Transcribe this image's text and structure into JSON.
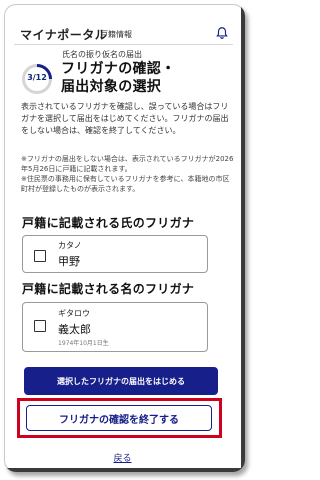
{
  "header": {
    "app_title": "マイナポータル",
    "section": "戸籍情報"
  },
  "progress": {
    "label": "3/12",
    "fraction": 0.25
  },
  "page": {
    "subheading": "氏名の振り仮名の届出",
    "title_line1": "フリガナの確認・",
    "title_line2": "届出対象の選択"
  },
  "description": "表示されているフリガナを確認し、誤っている場合はフリガナを選択して届出をはじめてください。フリガナの届出をしない場合は、確認を終了してください。",
  "notes": [
    "※フリガナの届出をしない場合は、表示されているフリガナが2026年5月26日に戸籍に記載されます。",
    "※住民票の事務用に保有しているフリガナを参考に、本籍地の市区町村が登録したものが表示されます。"
  ],
  "surname_section": {
    "title": "戸籍に記載される氏のフリガナ",
    "kana": "カタノ",
    "kanji": "甲野"
  },
  "given_section": {
    "title": "戸籍に記載される名のフリガナ",
    "kana": "ギタロウ",
    "kanji": "義太郎",
    "birth_date": "1974年10月1日生"
  },
  "buttons": {
    "start_notification": "選択したフリガナの届出をはじめる",
    "finish_confirmation": "フリガナの確認を終了する",
    "back": "戻る"
  },
  "colors": {
    "primary": "#17208a",
    "highlight": "#d0001f"
  }
}
